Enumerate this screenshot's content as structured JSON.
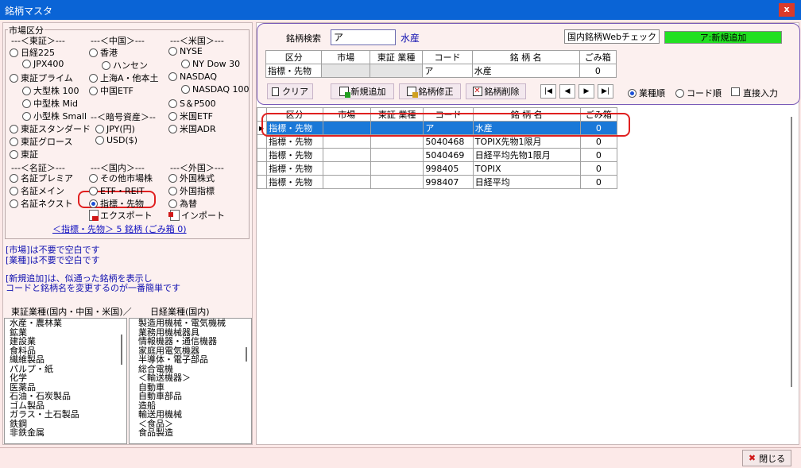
{
  "window": {
    "title": "銘柄マスタ",
    "close_glyph": "x"
  },
  "market": {
    "group_title": "市場区分",
    "tosho_header": "---＜東証＞---",
    "china_header": "---＜中国＞---",
    "us_header": "---＜米国＞---",
    "tosho": [
      "日経225",
      "JPX400",
      "東証プライム",
      "大型株 100",
      "中型株 Mid",
      "小型株 Small",
      "東証スタンダード",
      "東証グロース",
      "東証"
    ],
    "china": [
      "香港",
      "ハンセン",
      "上海A・他本土",
      "中国ETF"
    ],
    "us": [
      "NYSE",
      "NY Dow 30",
      "NASDAQ",
      "NASDAQ 100",
      "S＆P500",
      "米国ETF",
      "米国ADR"
    ],
    "crypto_header": "--＜暗号資産＞--",
    "crypto": [
      "JPY(円)",
      "USD($)"
    ],
    "meisho_header": "---＜名証＞---",
    "domestic_header": "---＜国内＞---",
    "foreign_header": "---＜外国＞---",
    "meisho": [
      "名証プレミア",
      "名証メイン",
      "名証ネクスト"
    ],
    "domestic": [
      "その他市場株",
      "ETF・REIT",
      "指標・先物"
    ],
    "foreign": [
      "外国株式",
      "外国指標",
      "為替"
    ],
    "selected": "指標・先物",
    "export_label": "エクスポート",
    "import_label": "インポート",
    "summary_link": "＜指標・先物＞ 5 銘柄 (ごみ箱 0)"
  },
  "notes": {
    "line1": "[市場]は不要で空白です",
    "line2": "[業種]は不要で空白です",
    "line3": "[新規追加]は、似通った銘柄を表示し",
    "line4": "コードと銘柄名を変更するのが一番簡単です"
  },
  "industry": {
    "header_left": "東証業種(国内・中国・米国)／",
    "header_right": "日経業種(国内)",
    "left_items": [
      "水産・農林業",
      "鉱業",
      "建設業",
      "食料品",
      "繊維製品",
      "パルプ・紙",
      "化学",
      "医薬品",
      "石油・石炭製品",
      "ゴム製品",
      "ガラス・土石製品",
      "鉄鋼",
      "非鉄金属"
    ],
    "right_items": [
      "製造用機械・電気機械",
      "業務用機械器具",
      "情報機器・通信機器",
      "家庭用電気機器",
      "半導体・電子部品",
      "総合電機",
      "＜輸送機器＞",
      "自動車",
      "自動車部品",
      "造船",
      "輸送用機械",
      "＜食品＞",
      "食品製造"
    ]
  },
  "search": {
    "label": "銘柄検索",
    "value": "ア",
    "result_name": "水産",
    "web_check_label": "国内銘柄Webチェック",
    "status_badge": "ア:新規追加",
    "status_color": "#22e022"
  },
  "edit_grid": {
    "headers": [
      "区分",
      "市場",
      "東証 業種",
      "コード",
      "銘 柄 名",
      "ごみ箱"
    ],
    "row": [
      "指標・先物",
      "",
      "",
      "ア",
      "水産",
      "0"
    ]
  },
  "buttons": {
    "clear": "クリア",
    "add": "新規追加",
    "modify": "銘柄修正",
    "delete": "銘柄削除",
    "close": "閉じる"
  },
  "sort": {
    "industry": "業種順",
    "code": "コード順",
    "direct": "直接入力",
    "selected": "業種順"
  },
  "list": {
    "headers": [
      "区分",
      "市場",
      "東証 業種",
      "コード",
      "銘 柄 名",
      "ごみ箱"
    ],
    "rows": [
      [
        "指標・先物",
        "",
        "",
        "ア",
        "水産",
        "0"
      ],
      [
        "指標・先物",
        "",
        "",
        "5040468",
        "TOPIX先物1限月",
        "0"
      ],
      [
        "指標・先物",
        "",
        "",
        "5040469",
        "日経平均先物1限月",
        "0"
      ],
      [
        "指標・先物",
        "",
        "",
        "998405",
        "TOPIX",
        "0"
      ],
      [
        "指標・先物",
        "",
        "",
        "998407",
        "日経平均",
        "0"
      ]
    ]
  }
}
